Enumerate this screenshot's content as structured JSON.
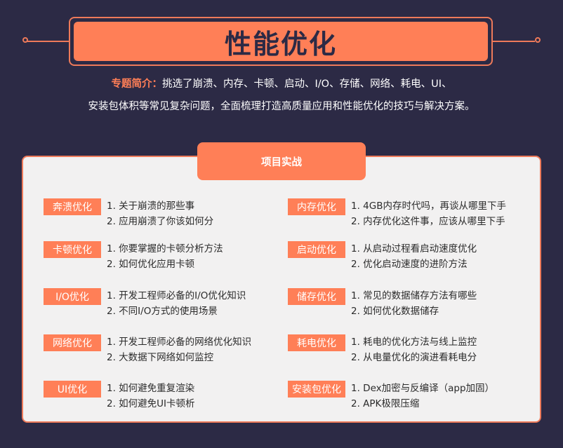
{
  "title": "性能优化",
  "intro": {
    "label": "专题简介：",
    "line1": "挑选了崩溃、内存、卡顿、启动、I/O、存储、网络、耗电、UI、",
    "line2": "安装包体积等常见复杂问题，全面梳理打造高质量应用和性能优化的技巧与解决方案。"
  },
  "panel": {
    "tab": "项目实战"
  },
  "left_items": [
    {
      "label": "奔溃优化",
      "l1": "1. 关于崩溃的那些事",
      "l2": "2. 应用崩溃了你该如何分"
    },
    {
      "label": "卡顿优化",
      "l1": "1. 你要掌握的卡顿分析方法",
      "l2": "2. 如何优化应用卡顿"
    },
    {
      "label": "I/O优化",
      "l1": "1. 开发工程师必备的I/O优化知识",
      "l2": "2. 不同I/O方式的使用场景"
    },
    {
      "label": "网络优化",
      "l1": "1. 开发工程师必备的网络优化知识",
      "l2": "2. 大数据下网络如何监控"
    },
    {
      "label": "UI优化",
      "l1": "1. 如何避免重复渲染",
      "l2": "2. 如何避免UI卡顿析"
    }
  ],
  "right_items": [
    {
      "label": "内存优化",
      "l1": "1. 4GB内存时代吗，再谈从哪里下手",
      "l2": "2. 内存优化这件事，应该从哪里下手"
    },
    {
      "label": "启动优化",
      "l1": "1. 从启动过程看启动速度优化",
      "l2": "2. 优化启动速度的进阶方法"
    },
    {
      "label": "储存优化",
      "l1": "1. 常见的数据储存方法有哪些",
      "l2": "2. 如何优化数据储存"
    },
    {
      "label": "耗电优化",
      "l1": "1. 耗电的优化方法与线上监控",
      "l2": "2. 从电量优化的演进看耗电分"
    },
    {
      "label": "安装包优化",
      "l1": "1. Dex加密与反编译（app加固）",
      "l2": "2. APK极限压缩"
    }
  ]
}
